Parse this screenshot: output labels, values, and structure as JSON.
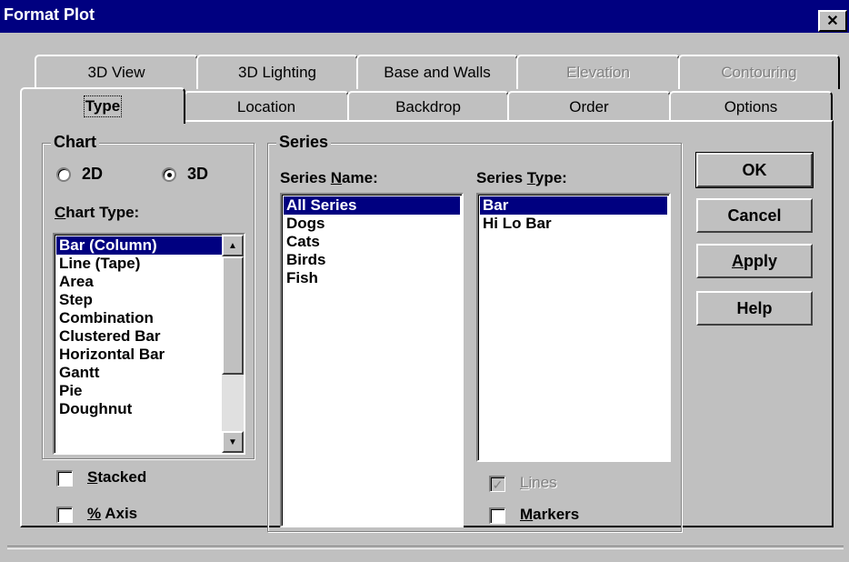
{
  "window": {
    "title": "Format Plot",
    "close_glyph": "✕"
  },
  "tabs_back": [
    {
      "label": "3D View",
      "enabled": true
    },
    {
      "label": "3D Lighting",
      "enabled": true
    },
    {
      "label": "Base and Walls",
      "enabled": true
    },
    {
      "label": "Elevation",
      "enabled": false
    },
    {
      "label": "Contouring",
      "enabled": false
    }
  ],
  "tabs_front": [
    {
      "label": "Type",
      "active": true
    },
    {
      "label": "Location",
      "active": false
    },
    {
      "label": "Backdrop",
      "active": false
    },
    {
      "label": "Order",
      "active": false
    },
    {
      "label": "Options",
      "active": false
    }
  ],
  "chart_group": {
    "title": "Chart",
    "radio_2d": {
      "label": "2D",
      "checked": false
    },
    "radio_3d": {
      "label": "3D",
      "checked": true
    },
    "chart_type_label_u": "C",
    "chart_type_label_rest": "hart Type:",
    "chart_types": [
      "Bar (Column)",
      "Line (Tape)",
      "Area",
      "Step",
      "Combination",
      "Clustered Bar",
      "Horizontal Bar",
      "Gantt",
      "Pie",
      "Doughnut"
    ],
    "selected_index": 0
  },
  "stacked": {
    "u": "S",
    "rest": "tacked",
    "checked": false
  },
  "percent_axis": {
    "u": "%",
    "rest": " Axis",
    "checked": false
  },
  "series_group": {
    "title": "Series",
    "name_label_pre": "Series ",
    "name_label_u": "N",
    "name_label_post": "ame:",
    "names": [
      "All Series",
      "Dogs",
      "Cats",
      "Birds",
      "Fish"
    ],
    "selected_name_index": 0,
    "type_label_pre": "Series ",
    "type_label_u": "T",
    "type_label_post": "ype:",
    "types": [
      "Bar",
      "Hi Lo Bar"
    ],
    "selected_type_index": 0
  },
  "lines": {
    "u": "L",
    "rest": "ines",
    "checked": true,
    "enabled": false
  },
  "markers": {
    "u": "M",
    "rest": "arkers",
    "checked": false,
    "enabled": true
  },
  "buttons": {
    "ok": "OK",
    "cancel": "Cancel",
    "apply_u": "A",
    "apply_rest": "pply",
    "help": "Help"
  },
  "icons": {
    "scroll_up": "▲",
    "scroll_down": "▼",
    "check": "✓"
  },
  "colors": {
    "title_bar": "#000080",
    "face": "#c0c0c0",
    "selection": "#000080"
  }
}
